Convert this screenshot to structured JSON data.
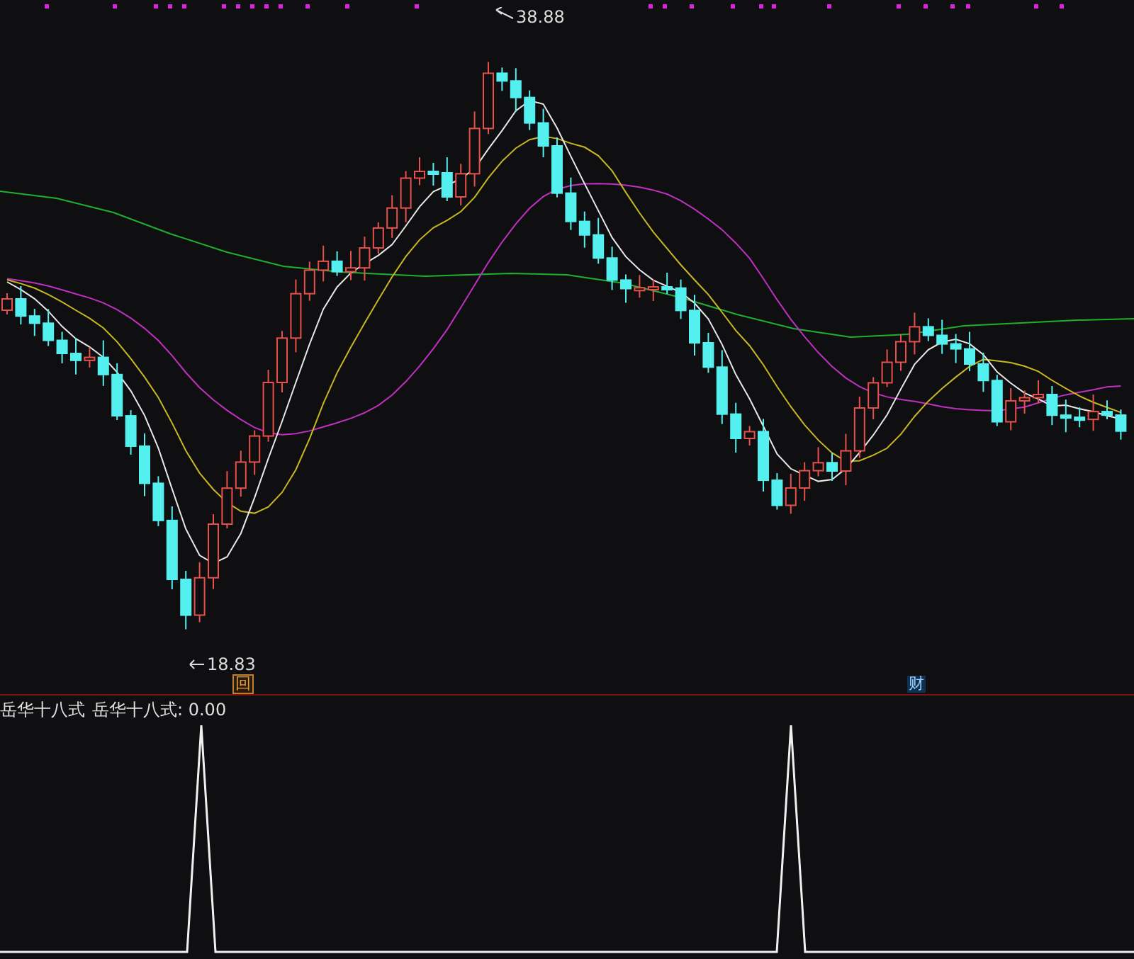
{
  "price_chart": {
    "high_label": "38.88",
    "low_label": "18.83",
    "markers": [
      {
        "kind": "review",
        "label": "回"
      },
      {
        "kind": "finance",
        "label": "财"
      }
    ]
  },
  "indicator": {
    "title": "岳华十八式",
    "readout": "岳华十八式: 0.00"
  }
}
